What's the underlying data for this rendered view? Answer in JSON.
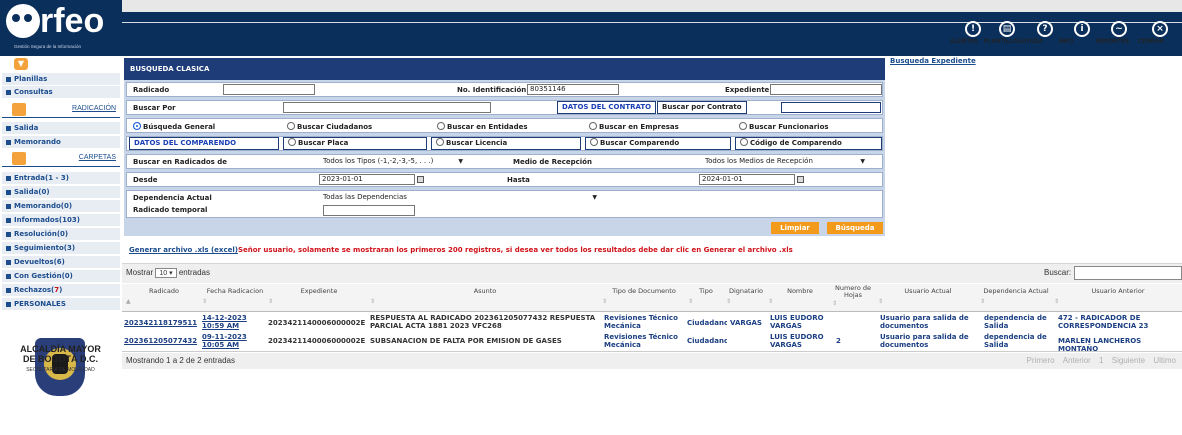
{
  "header": {
    "logo_text": "rfeo",
    "logo_subtitle": "Gestión Segura de la Información",
    "nav": [
      {
        "label": "ALERTAS",
        "icon": "exclamation-icon"
      },
      {
        "label": "PLANTILLAS",
        "icon": "template-icon"
      },
      {
        "label": "AYUDA",
        "icon": "question-icon"
      },
      {
        "label": "INFO",
        "icon": "info-icon"
      },
      {
        "label": "REPORTES",
        "icon": "reports-icon"
      },
      {
        "label": "CERRAR",
        "icon": "close-icon"
      }
    ]
  },
  "sidebar": {
    "top_links": [
      "Planillas",
      "Consultas"
    ],
    "radicacion_title": "RADICACIÓN",
    "radicacion_links": [
      "Salida",
      "Memorando"
    ],
    "carpetas_title": "CARPETAS",
    "carpetas": [
      {
        "label": "Entrada(1 - 3)"
      },
      {
        "label": "Salida(0)"
      },
      {
        "label": "Memorando(0)"
      },
      {
        "label": "Informados(103)"
      },
      {
        "label": "Resolución(0)"
      },
      {
        "label": "Seguimiento(3)"
      },
      {
        "label": "Devueltos(6)"
      },
      {
        "label": "Con Gestión(0)"
      },
      {
        "label_prefix": "Rechazos(",
        "label_red": "7",
        "label_suffix": ")"
      },
      {
        "label": "PERSONALES"
      }
    ],
    "alcaldia_line1": "ALCALDÍA MAYOR",
    "alcaldia_line2": "DE BOGOTÁ D.C.",
    "secretaria": "SECRETARÍA DE MOVILIDAD"
  },
  "form": {
    "title": "BUSQUEDA CLASICA",
    "radicado_label": "Radicado",
    "no_identificacion_label": "No. Identificación",
    "no_identificacion_value": "80351146",
    "expediente_label": "Expediente",
    "buscar_por_label": "Buscar Por",
    "datos_contrato": "DATOS DEL CONTRATO",
    "buscar_por_contrato": "Buscar por Contrato",
    "radios_row1": [
      "Búsqueda General",
      "Buscar Ciudadanos",
      "Buscar en Entidades",
      "Buscar en Empresas",
      "Buscar Funcionarios"
    ],
    "datos_comparendo": "DATOS DEL COMPARENDO",
    "radios_row2": [
      "Buscar Placa",
      "Buscar Licencia",
      "Buscar Comparendo",
      "Código de Comparendo"
    ],
    "buscar_radicados_label": "Buscar en Radicados de",
    "tipos_value": "Todos los Tipos (-1,-2,-3,-5, . . .)",
    "medio_recepcion_label": "Medio de Recepción",
    "medios_value": "Todos los Medios de Recepción",
    "desde_label": "Desde",
    "desde_value": "2023-01-01",
    "hasta_label": "Hasta",
    "hasta_value": "2024-01-01",
    "dependencia_label": "Dependencia Actual",
    "dependencia_value": "Todas las Dependencias",
    "radicado_temporal_label": "Radicado temporal",
    "limpiar": "Limpiar",
    "busqueda": "Búsqueda"
  },
  "busqueda_expediente": "Busqueda Expediente",
  "notice": {
    "link": "Generar archivo .xls (excel)",
    "message": "Señor usuario, solamente se mostraran los primeros 200 registros, si desea ver todos los resultados debe dar clic en Generar el archivo .xls"
  },
  "table": {
    "mostrar": "Mostrar",
    "page_size": "10",
    "entradas": "entradas",
    "buscar": "Buscar:",
    "columns": [
      "Radicado",
      "Fecha Radicacion",
      "Expediente",
      "Asunto",
      "Tipo de Documento",
      "Tipo",
      "Dignatario",
      "Nombre",
      "Numero de Hojas",
      "Usuario Actual",
      "Dependencia Actual",
      "Usuario Anterior"
    ],
    "rows": [
      {
        "radicado": "202342118179511",
        "fecha1": "14-12-2023",
        "fecha2": "10:59 AM",
        "expediente": "2023421140006000002E",
        "asunto": "RESPUESTA AL RADICADO 202361205077432 RESPUESTA PARCIAL ACTA 1881 2023 VFC268",
        "tipo_documento": "Revisiones Técnico Mecánica",
        "tipo": "Ciudadano",
        "dignatario": "VARGAS",
        "nombre": "LUIS EUDORO VARGAS",
        "hojas": "",
        "usuario_actual": "Usuario para salida de documentos",
        "dependencia_actual": "dependencia de Salida",
        "usuario_anterior": "472 - RADICADOR DE CORRESPONDENCIA 23"
      },
      {
        "radicado": "202361205077432",
        "fecha1": "09-11-2023",
        "fecha2": "10:05 AM",
        "expediente": "2023421140006000002E",
        "asunto": "SUBSANACION DE FALTA POR EMISION DE GASES",
        "tipo_documento": "Revisiones Técnico Mecánica",
        "tipo": "Ciudadano",
        "dignatario": "",
        "nombre": "LUIS EUDORO VARGAS",
        "hojas": "2",
        "usuario_actual": "Usuario para salida de documentos",
        "dependencia_actual": "dependencia de Salida",
        "usuario_anterior": "MARLEN LANCHEROS MONTAÑO"
      }
    ],
    "footer_info": "Mostrando 1 a 2 de 2 entradas",
    "pagination": [
      "Primero",
      "Anterior",
      "1",
      "Siguiente",
      "Ultimo"
    ]
  },
  "colors": {
    "header_bg": "#0b2f5b",
    "form_title_bg": "#1d3c78",
    "accent_orange": "#f39a1b",
    "link_blue": "#1b4c8c",
    "notice_red": "#d0121a"
  }
}
